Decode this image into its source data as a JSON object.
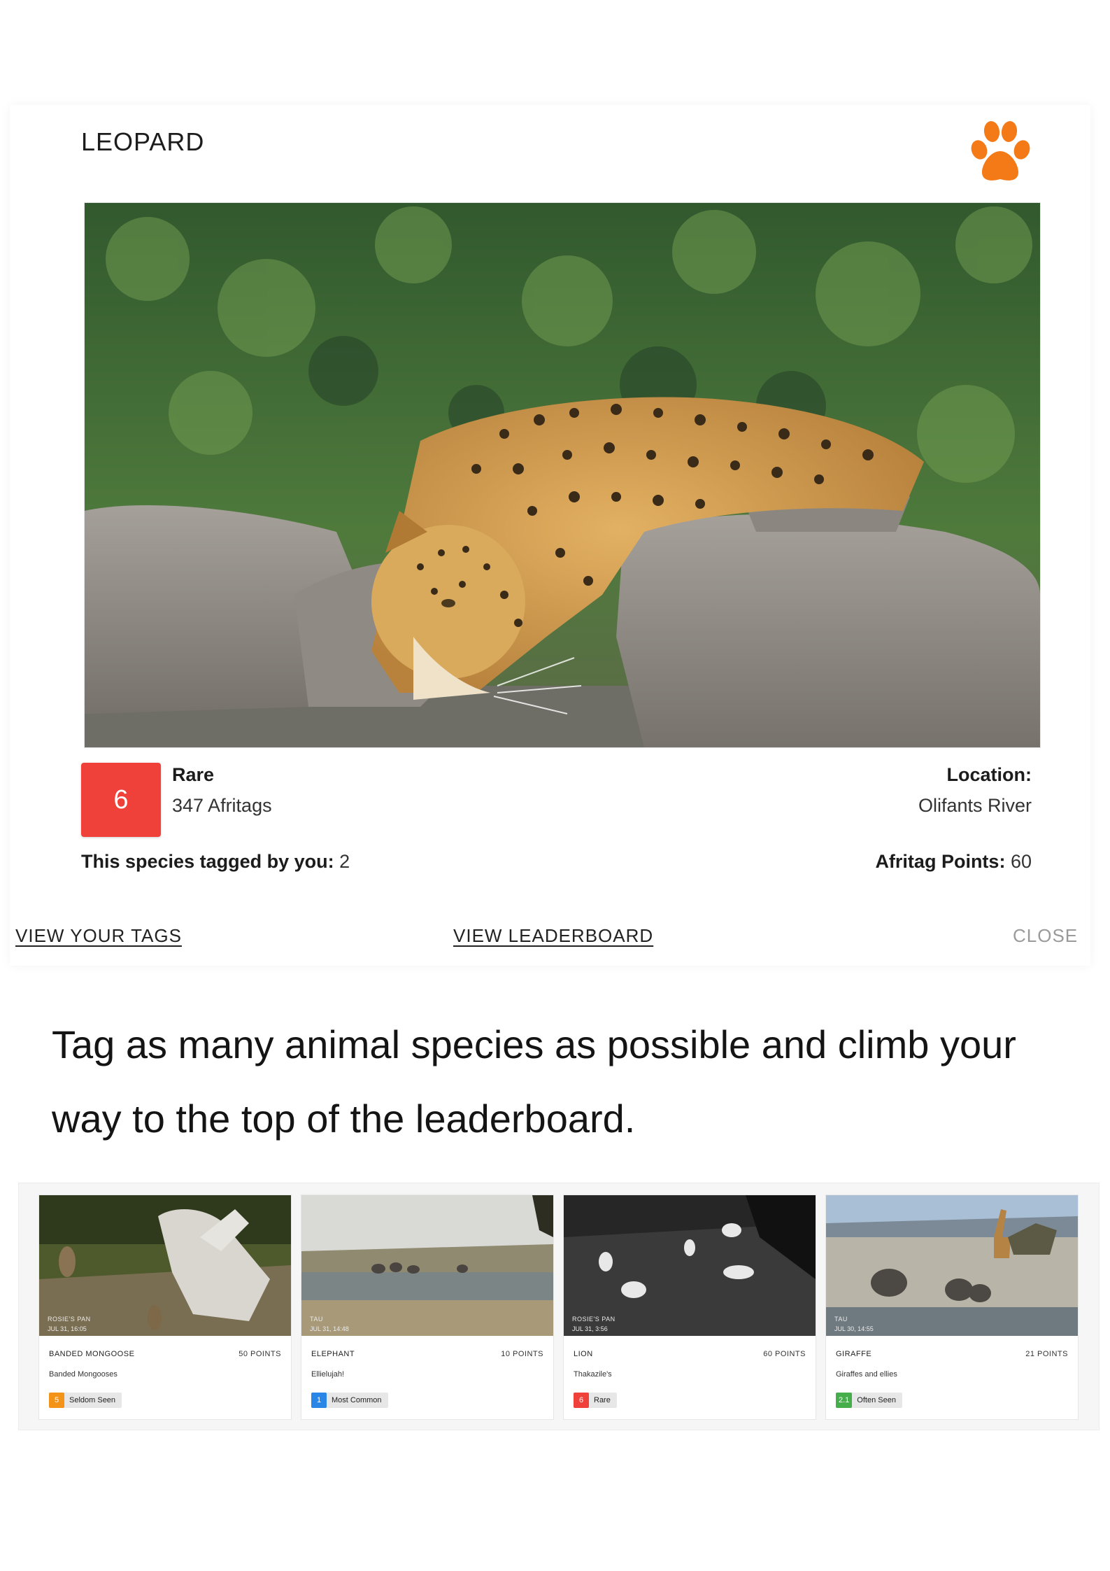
{
  "modal": {
    "title": "LEOPARD",
    "paw_icon": "paw-icon",
    "paw_color": "#f47a18",
    "rarity_score": "6",
    "rarity_color": "#f0403a",
    "rarity_label": "Rare",
    "tag_count": "347 Afritags",
    "location_label": "Location:",
    "location_value": "Olifants River",
    "tagged_label": "This species tagged by you:",
    "tagged_value": "2",
    "points_label": "Afritag Points:",
    "points_value": "60",
    "actions": {
      "view_tags": "VIEW YOUR TAGS",
      "view_leaderboard": "VIEW LEADERBOARD",
      "close": "CLOSE"
    }
  },
  "tagline": "Tag as many animal species as possible and climb your way to the top of the leaderboard.",
  "cards": [
    {
      "location": "ROSIE'S PAN",
      "time": "JUL 31, 16:05",
      "species": "BANDED MONGOOSE",
      "points": "50 POINTS",
      "name": "Banded Mongooses",
      "rarity_num": "5",
      "rarity_label": "Seldom Seen",
      "rarity_color": "#f39418"
    },
    {
      "location": "TAU",
      "time": "JUL 31, 14:48",
      "species": "ELEPHANT",
      "points": "10 POINTS",
      "name": "Ellielujah!",
      "rarity_num": "1",
      "rarity_label": "Most Common",
      "rarity_color": "#2a86e6"
    },
    {
      "location": "ROSIE'S PAN",
      "time": "JUL 31, 3:56",
      "species": "LION",
      "points": "60 POINTS",
      "name": "Thakazile's",
      "rarity_num": "6",
      "rarity_label": "Rare",
      "rarity_color": "#f0403a"
    },
    {
      "location": "TAU",
      "time": "JUL 30, 14:55",
      "species": "GIRAFFE",
      "points": "21 POINTS",
      "name": "Giraffes and ellies",
      "rarity_num": "2.1",
      "rarity_label": "Often Seen",
      "rarity_color": "#45ad4a"
    }
  ]
}
